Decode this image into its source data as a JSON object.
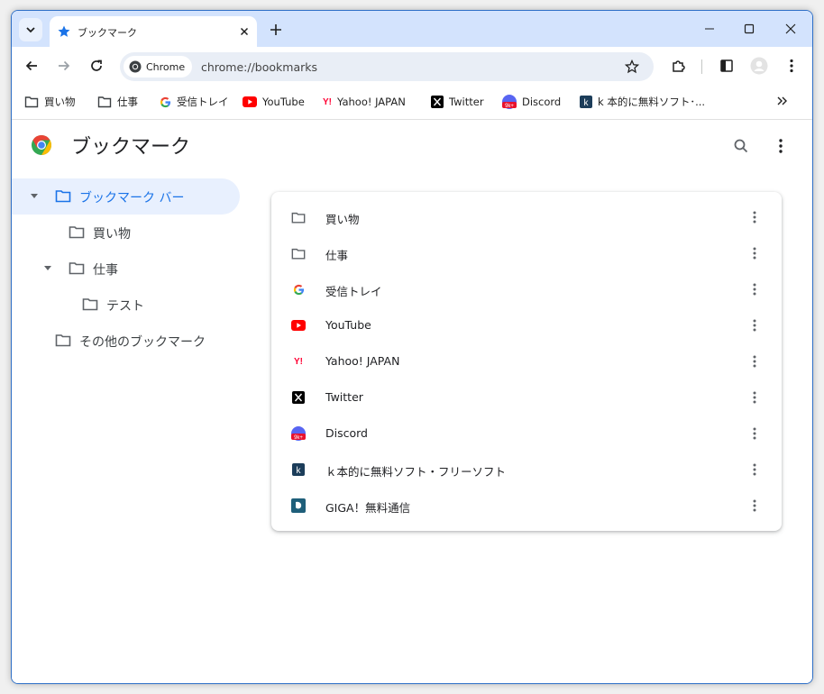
{
  "tab": {
    "title": "ブックマーク"
  },
  "omnibox": {
    "chip_label": "Chrome",
    "url": "chrome://bookmarks"
  },
  "bookmarks_bar": [
    {
      "label": "買い物",
      "icon": "folder-icon"
    },
    {
      "label": "仕事",
      "icon": "folder-icon"
    },
    {
      "label": "受信トレイ",
      "icon": "google-icon"
    },
    {
      "label": "YouTube",
      "icon": "youtube-icon"
    },
    {
      "label": "Yahoo! JAPAN",
      "icon": "yahoo-icon"
    },
    {
      "label": "Twitter",
      "icon": "x-icon"
    },
    {
      "label": "Discord",
      "icon": "discord-icon"
    },
    {
      "label": "k 本的に無料ソフト･...",
      "icon": "k-icon"
    }
  ],
  "page": {
    "title": "ブックマーク"
  },
  "tree": [
    {
      "label": "ブックマーク バー",
      "selected": true
    },
    {
      "label": "買い物"
    },
    {
      "label": "仕事"
    },
    {
      "label": "テスト"
    },
    {
      "label": "その他のブックマーク"
    }
  ],
  "list": [
    {
      "label": "買い物",
      "icon": "folder-icon"
    },
    {
      "label": "仕事",
      "icon": "folder-icon"
    },
    {
      "label": "受信トレイ",
      "icon": "google-icon"
    },
    {
      "label": "YouTube",
      "icon": "youtube-icon"
    },
    {
      "label": "Yahoo! JAPAN",
      "icon": "yahoo-icon"
    },
    {
      "label": "Twitter",
      "icon": "x-icon"
    },
    {
      "label": "Discord",
      "icon": "discord-icon"
    },
    {
      "label": "ｋ本的に無料ソフト・フリーソフト",
      "icon": "k-icon"
    },
    {
      "label": "GIGA！無料通信",
      "icon": "giga-icon"
    }
  ],
  "colors": {
    "accent": "#1a73e8",
    "tabstrip": "#d3e3fd",
    "selected_bg": "#e8f0fe",
    "youtube": "#ff0000",
    "yahoo": "#ff0033"
  }
}
